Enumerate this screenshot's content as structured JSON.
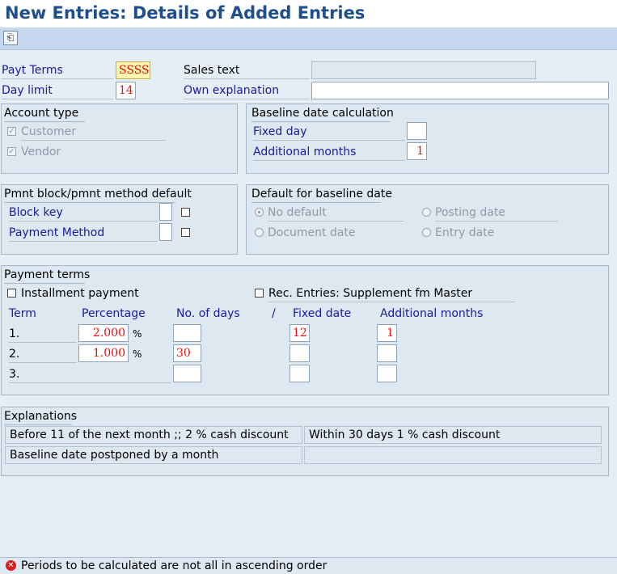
{
  "window": {
    "title": "New Entries: Details of Added Entries"
  },
  "toolbar": {
    "icon": "other-object-icon"
  },
  "header": {
    "payt_terms_label": "Payt Terms",
    "payt_terms_value": "SSSS",
    "day_limit_label": "Day limit",
    "day_limit_value": "14",
    "sales_text_label": "Sales text",
    "sales_text_value": "",
    "own_explanation_label": "Own explanation",
    "own_explanation_value": ""
  },
  "account_type": {
    "title": "Account type",
    "customer_label": "Customer",
    "vendor_label": "Vendor"
  },
  "baseline": {
    "title": "Baseline date calculation",
    "fixed_day_label": "Fixed day",
    "fixed_day_value": "",
    "additional_months_label": "Additional months",
    "additional_months_value": "1"
  },
  "pmnt_block": {
    "title": "Pmnt block/pmnt method default",
    "block_key_label": "Block key",
    "payment_method_label": "Payment Method"
  },
  "default_baseline": {
    "title": "Default for baseline date",
    "no_default": "No default",
    "posting_date": "Posting date",
    "document_date": "Document date",
    "entry_date": "Entry date"
  },
  "payment_terms": {
    "title": "Payment terms",
    "installment_label": "Installment payment",
    "rec_entries_label": "Rec. Entries: Supplement fm Master",
    "col_term": "Term",
    "col_percentage": "Percentage",
    "col_days": "No. of days",
    "col_slash": "/",
    "col_fixed_date": "Fixed date",
    "col_add_months": "Additional months",
    "percent_sign": "%",
    "rows": [
      {
        "term": "1.",
        "percentage": "2.000",
        "days": "",
        "fixed_date": "12",
        "add_months": "1"
      },
      {
        "term": "2.",
        "percentage": "1.000",
        "days": "30",
        "fixed_date": "",
        "add_months": ""
      },
      {
        "term": "3.",
        "percentage": "",
        "days": "",
        "fixed_date": "",
        "add_months": ""
      }
    ]
  },
  "explanations": {
    "title": "Explanations",
    "line1_left": "Before 11 of the next month ;; 2 % cash discount",
    "line1_right": "Within 30 days 1 % cash discount",
    "line2_left": "Baseline date postponed by a month",
    "line2_right": ""
  },
  "status": {
    "message": "Periods to be calculated are not all in ascending order",
    "icon": "error-icon"
  },
  "colors": {
    "title": "#1e4e8c",
    "label": "#1a1aa0",
    "value": "#e01010",
    "background": "#e5eef5"
  }
}
